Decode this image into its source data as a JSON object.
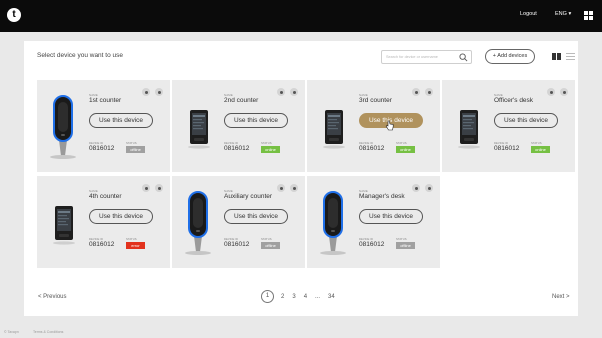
{
  "header": {
    "logo_text": "t",
    "logout": "Logout",
    "language": "ENG ▾",
    "apps_icon": "grid-icon"
  },
  "toolbar": {
    "title": "Select device you want to use",
    "search_placeholder": "Search for device or username",
    "add_devices": "+ Add devices",
    "view_grid_icon": "grid-view-icon",
    "view_list_icon": "list-view-icon"
  },
  "labels": {
    "name": "NAME",
    "device_id": "DEVICE ID",
    "status": "STATUS",
    "use_button": "Use this device"
  },
  "devices": [
    {
      "name": "1st counter",
      "device_id": "0816012",
      "status": "offline",
      "type": "kiosk",
      "active": false
    },
    {
      "name": "2nd counter",
      "device_id": "0816012",
      "status": "online",
      "type": "terminal",
      "active": false
    },
    {
      "name": "3rd counter",
      "device_id": "0816012",
      "status": "online",
      "type": "terminal",
      "active": true
    },
    {
      "name": "Officer's desk",
      "device_id": "0816012",
      "status": "online",
      "type": "terminal",
      "active": false
    },
    {
      "name": "4th counter",
      "device_id": "0816012",
      "status": "error",
      "type": "terminal",
      "active": false
    },
    {
      "name": "Auxiliary counter",
      "device_id": "0816012",
      "status": "offline",
      "type": "kiosk",
      "active": false
    },
    {
      "name": "Manager's desk",
      "device_id": "0816012",
      "status": "offline",
      "type": "kiosk",
      "active": false
    }
  ],
  "pagination": {
    "prev": "< Previous",
    "next": "Next >",
    "pages": [
      "1",
      "2",
      "3",
      "4",
      "...",
      "34"
    ],
    "current": "1"
  },
  "footer": {
    "copyright": "© Tavapn",
    "terms": "Terms & Conditions"
  },
  "colors": {
    "accent": "#b0925d",
    "online": "#76c043",
    "offline": "#a0a0a0",
    "error": "#e2321d",
    "kiosk_ring": "#1f6fe8"
  }
}
